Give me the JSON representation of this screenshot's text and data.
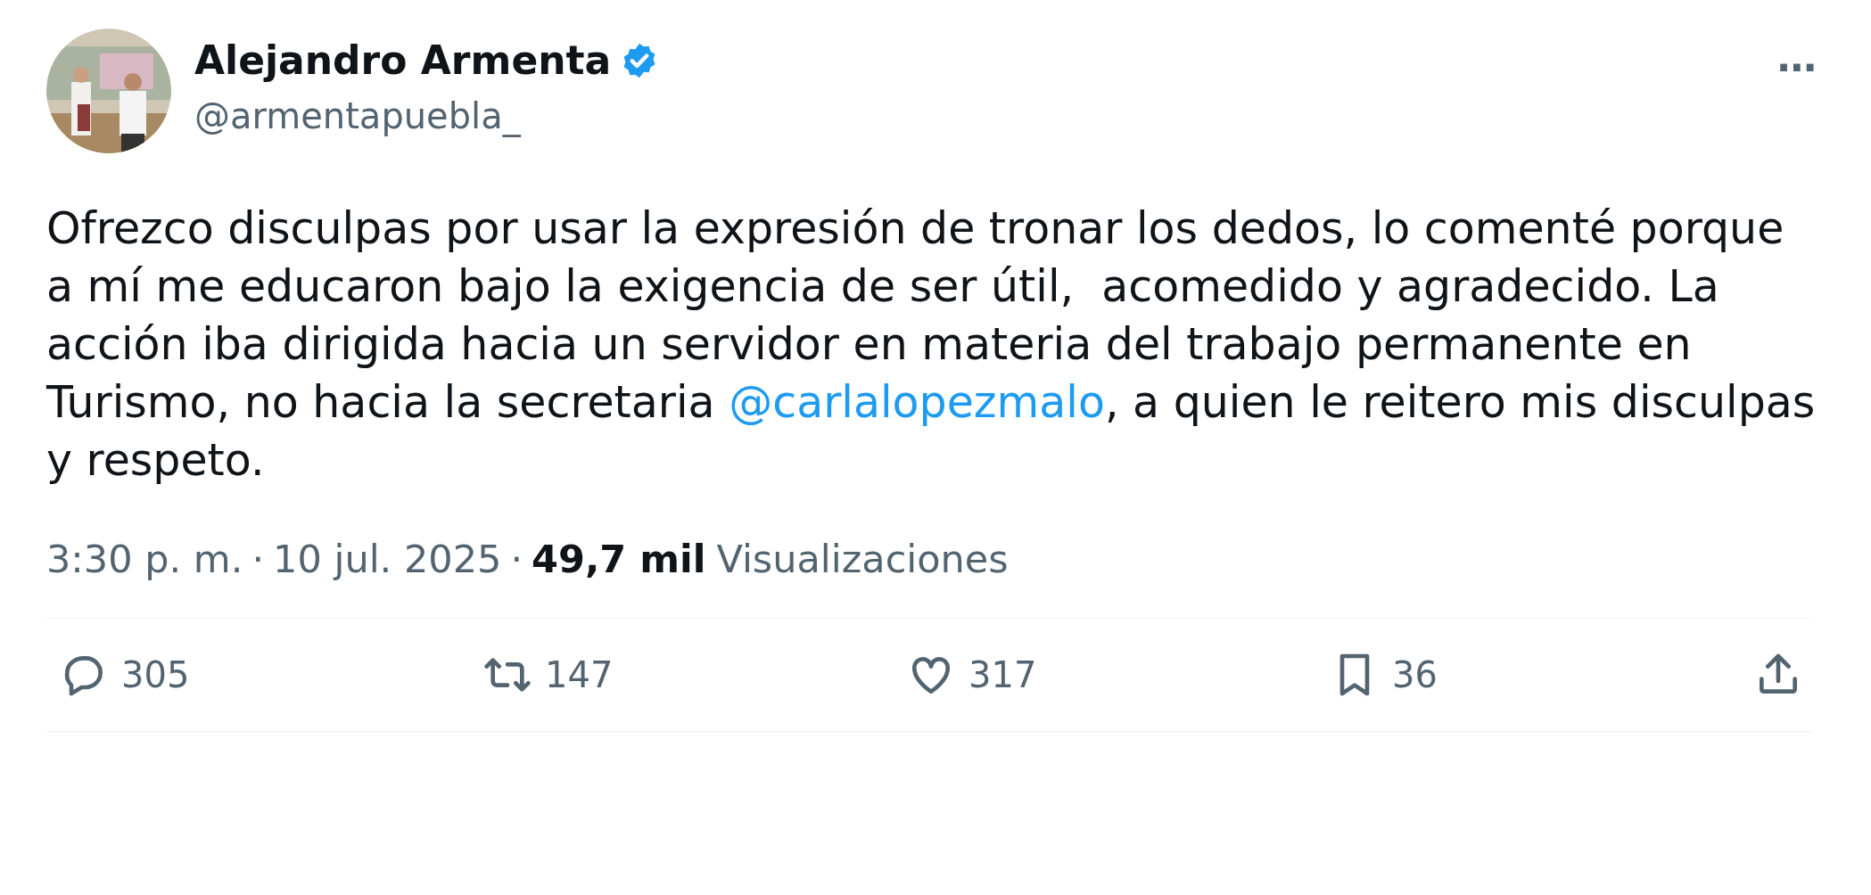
{
  "author": {
    "name": "Alejandro Armenta",
    "verified": true,
    "handle": "@armentapuebla_"
  },
  "more_button": "···",
  "body": {
    "text_before": "Ofrezco disculpas por usar la expresión de tronar los dedos, lo comenté porque a mí me educaron bajo la exigencia de ser útil,  acomedido y agradecido. La acción iba dirigida hacia un servidor en materia del trabajo permanente en Turismo, no hacia la secretaria ",
    "mention": "@carlalopezmalo",
    "text_after": ", a quien le reitero mis disculpas y respeto."
  },
  "meta": {
    "time": "3:30 p. m.",
    "separator_1": "·",
    "date": "10 jul. 2025",
    "separator_2": "·",
    "views_count": "49,7 mil",
    "views_label": "Visualizaciones"
  },
  "actions": [
    {
      "kind": "reply",
      "count": "305"
    },
    {
      "kind": "repost",
      "count": "147"
    },
    {
      "kind": "like",
      "count": "317"
    },
    {
      "kind": "bookmark",
      "count": "36"
    },
    {
      "kind": "share"
    }
  ]
}
